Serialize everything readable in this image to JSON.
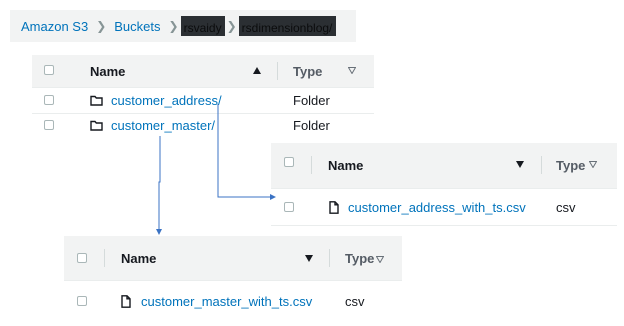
{
  "breadcrumb": {
    "items": [
      "Amazon S3",
      "Buckets",
      "rsvaidy",
      "rsdimensionblog/"
    ]
  },
  "root_table": {
    "header": {
      "name": "Name",
      "type": "Type"
    },
    "rows": [
      {
        "name": "customer_address/",
        "type": "Folder"
      },
      {
        "name": "customer_master/",
        "type": "Folder"
      }
    ]
  },
  "address_table": {
    "header": {
      "name": "Name",
      "type": "Type"
    },
    "rows": [
      {
        "name": "customer_address_with_ts.csv",
        "type": "csv"
      }
    ]
  },
  "master_table": {
    "header": {
      "name": "Name",
      "type": "Type"
    },
    "rows": [
      {
        "name": "customer_master_with_ts.csv",
        "type": "csv"
      }
    ]
  },
  "colors": {
    "link": "#0073bb",
    "header_bg": "#f2f3f3",
    "connector": "#3b73c4"
  }
}
